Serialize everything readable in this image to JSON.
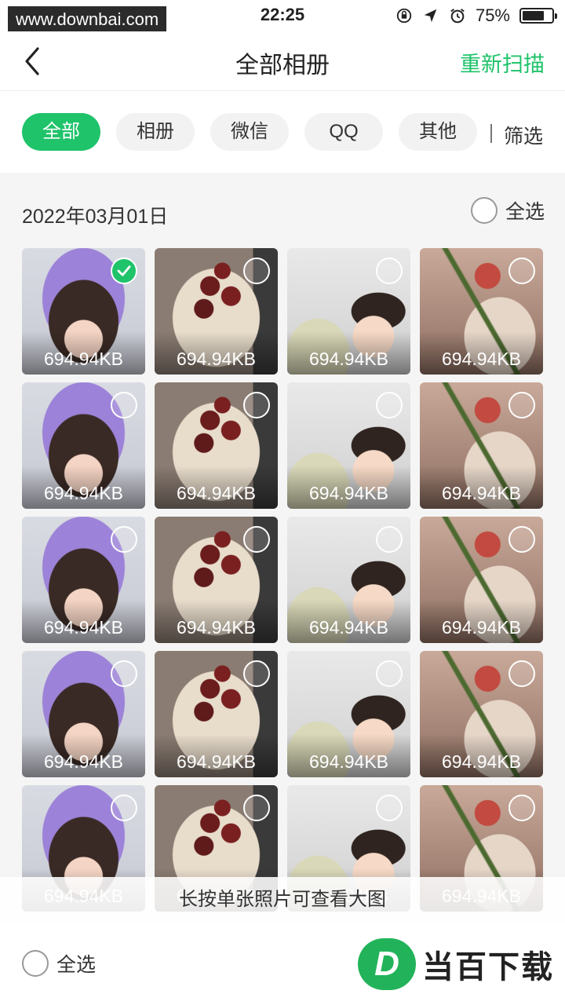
{
  "status_bar": {
    "watermark": "www.downbai.com",
    "time": "22:25",
    "battery_percent": "75%",
    "battery_level": 0.75,
    "icons": [
      "orientation-lock-icon",
      "location-icon",
      "alarm-icon",
      "battery-icon"
    ]
  },
  "header": {
    "back_icon": "chevron-left-icon",
    "title": "全部相册",
    "rescan_label": "重新扫描"
  },
  "filters": {
    "tabs": [
      {
        "label": "全部",
        "active": true
      },
      {
        "label": "相册",
        "active": false
      },
      {
        "label": "微信",
        "active": false
      },
      {
        "label": "QQ",
        "active": false
      },
      {
        "label": "其他",
        "active": false
      }
    ],
    "filter_label": "筛选"
  },
  "group": {
    "date": "2022年03月01日",
    "select_all_label": "全选"
  },
  "photos": [
    {
      "type": "girl",
      "size": "694.94KB",
      "checked": true
    },
    {
      "type": "rose",
      "size": "694.94KB",
      "checked": false
    },
    {
      "type": "baby",
      "size": "694.94KB",
      "checked": false
    },
    {
      "type": "flower",
      "size": "694.94KB",
      "checked": false
    },
    {
      "type": "girl",
      "size": "694.94KB",
      "checked": false
    },
    {
      "type": "rose",
      "size": "694.94KB",
      "checked": false
    },
    {
      "type": "baby",
      "size": "694.94KB",
      "checked": false
    },
    {
      "type": "flower",
      "size": "694.94KB",
      "checked": false
    },
    {
      "type": "girl",
      "size": "694.94KB",
      "checked": false
    },
    {
      "type": "rose",
      "size": "694.94KB",
      "checked": false
    },
    {
      "type": "baby",
      "size": "694.94KB",
      "checked": false
    },
    {
      "type": "flower",
      "size": "694.94KB",
      "checked": false
    },
    {
      "type": "girl",
      "size": "694.94KB",
      "checked": false
    },
    {
      "type": "rose",
      "size": "694.94KB",
      "checked": false
    },
    {
      "type": "baby",
      "size": "694.94KB",
      "checked": false
    },
    {
      "type": "flower",
      "size": "694.94KB",
      "checked": false
    },
    {
      "type": "girl",
      "size": "694.94KB",
      "checked": false
    },
    {
      "type": "rose",
      "size": "694.94KB",
      "checked": false
    },
    {
      "type": "baby",
      "size": "694.94KB",
      "checked": false
    },
    {
      "type": "flower",
      "size": "694.94KB",
      "checked": false
    }
  ],
  "toast": "长按单张照片可查看大图",
  "bottom_bar": {
    "select_all_label": "全选",
    "logo_badge": "D",
    "logo_text": "当百下载"
  },
  "colors": {
    "accent": "#1fc36a"
  }
}
